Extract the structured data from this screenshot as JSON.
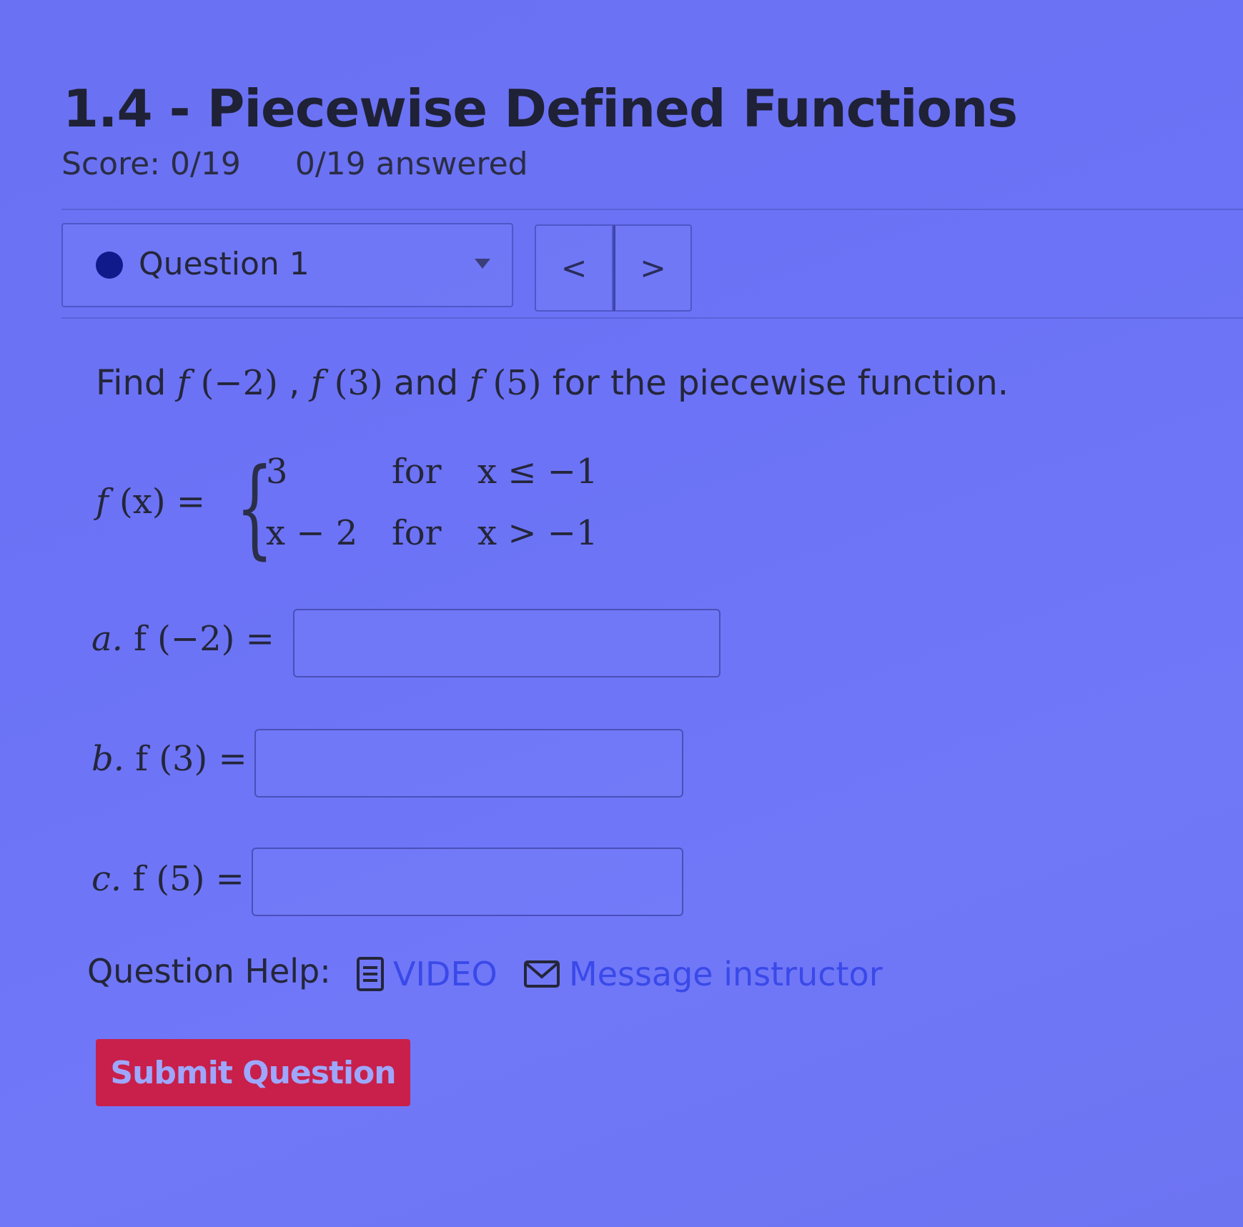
{
  "header": {
    "title": "1.4 - Piecewise Defined Functions",
    "score": "Score: 0/19",
    "answered": "0/19 answered"
  },
  "question_nav": {
    "selected": "Question 1",
    "prev_symbol": "<",
    "next_symbol": ">"
  },
  "question": {
    "prompt_find": "Find ",
    "f": "f",
    "arg1": "(−2)",
    "sep1": " , ",
    "arg2": "(3)",
    "and": " and ",
    "arg3": "(5)",
    "rest": " for the piecewise function.",
    "fx_lhs": "f",
    "fx_arg": "(x)",
    "eq": " =",
    "cases": [
      {
        "expr": "3",
        "kw": "for",
        "cond": "x ≤ −1"
      },
      {
        "expr": "x − 2",
        "kw": "for",
        "cond": "x > −1"
      }
    ],
    "parts": [
      {
        "label": "a.",
        "call": "f (−2) =",
        "value": ""
      },
      {
        "label": "b.",
        "call": "f (3) =",
        "value": ""
      },
      {
        "label": "c.",
        "call": "f (5) =",
        "value": ""
      }
    ]
  },
  "help": {
    "label": "Question Help:",
    "video": "VIDEO",
    "message": "Message instructor"
  },
  "submit_label": "Submit Question",
  "colors": {
    "background": "#6c73f6",
    "submit": "#c8204a",
    "link": "#3a49e8",
    "dot": "#101a8a"
  }
}
